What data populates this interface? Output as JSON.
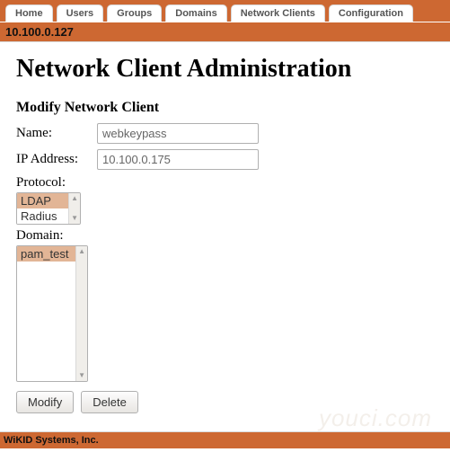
{
  "nav": {
    "tabs": [
      "Home",
      "Users",
      "Groups",
      "Domains",
      "Network Clients",
      "Configuration"
    ]
  },
  "ipbar": "10.100.0.127",
  "page": {
    "title": "Network Client Administration",
    "subtitle": "Modify Network Client"
  },
  "form": {
    "name_label": "Name:",
    "name_value": "webkeypass",
    "ip_label": "IP Address:",
    "ip_value": "10.100.0.175",
    "protocol_label": "Protocol:",
    "protocol_options": [
      "LDAP",
      "Radius"
    ],
    "protocol_selected": "LDAP",
    "domain_label": "Domain:",
    "domain_options": [
      "pam_test"
    ],
    "domain_selected": "pam_test"
  },
  "buttons": {
    "modify": "Modify",
    "delete": "Delete"
  },
  "footer": {
    "company": "WiKID Systems, Inc."
  },
  "watermark": "youci.com"
}
